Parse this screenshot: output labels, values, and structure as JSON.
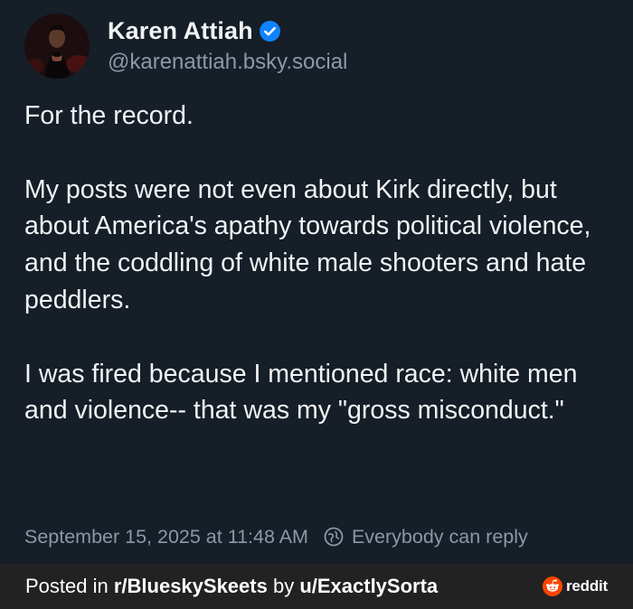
{
  "author": {
    "display_name": "Karen Attiah",
    "handle": "@karenattiah.bsky.social",
    "verified": true,
    "avatar_icon": "profile-photo"
  },
  "post": {
    "paragraphs": [
      "For the record.",
      "My posts were not even about Kirk directly, but about America's apathy towards political violence, and the coddling of white male shooters and hate peddlers.",
      "I was fired because I mentioned race: white men and violence-- that was my \"gross misconduct.\""
    ],
    "timestamp": "September 15, 2025 at 11:48 AM",
    "reply_setting": "Everybody can reply",
    "reply_icon": "globe-icon"
  },
  "footer": {
    "posted_in_prefix": "Posted in ",
    "subreddit": "r/BlueskySkeets",
    "by_text": " by ",
    "user": "u/ExactlySorta",
    "brand": "reddit",
    "brand_color": "#ff4500"
  },
  "colors": {
    "background": "#161e27",
    "text": "#f1f3f5",
    "muted": "#8b98a9",
    "verified": "#1083fe",
    "footer_bg": "#222222"
  }
}
